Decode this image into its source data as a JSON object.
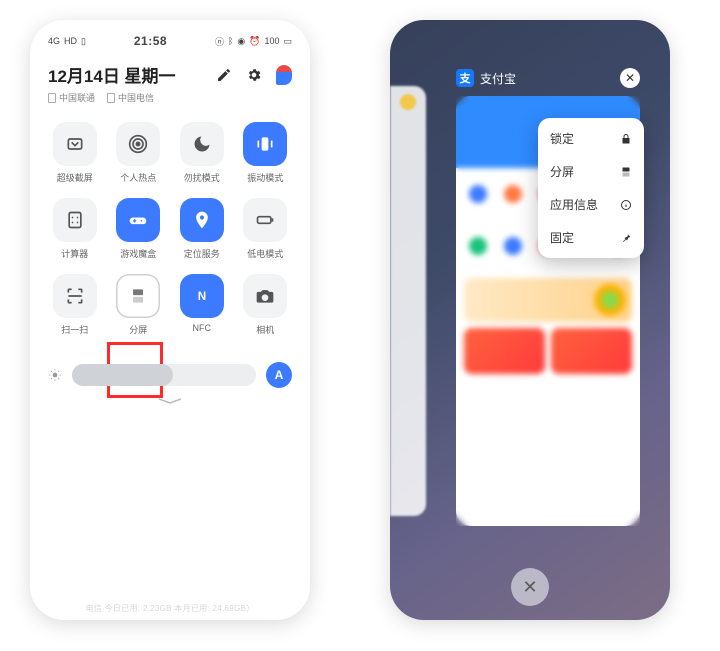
{
  "left": {
    "status": {
      "signal1": "4G",
      "signal2": "HD",
      "time": "21:58",
      "icons": [
        "nfc",
        "bt",
        "mute",
        "alarm",
        "batt_pct",
        "batt"
      ],
      "battery": "100"
    },
    "date": "12月14日 星期一",
    "sim1": "中国联通",
    "sim2": "中国电信",
    "tiles": [
      {
        "id": "super-screenshot",
        "label": "超级截屏",
        "active": false,
        "icon": "screenshot"
      },
      {
        "id": "hotspot",
        "label": "个人热点",
        "active": false,
        "icon": "hotspot"
      },
      {
        "id": "dnd",
        "label": "勿扰模式",
        "active": false,
        "icon": "moon"
      },
      {
        "id": "vibrate",
        "label": "振动模式",
        "active": true,
        "icon": "vibrate"
      },
      {
        "id": "calculator",
        "label": "计算器",
        "active": false,
        "icon": "calc"
      },
      {
        "id": "game-box",
        "label": "游戏魔盒",
        "active": true,
        "icon": "gamepad"
      },
      {
        "id": "location",
        "label": "定位服务",
        "active": true,
        "icon": "pin"
      },
      {
        "id": "low-power",
        "label": "低电模式",
        "active": false,
        "icon": "battery"
      },
      {
        "id": "scan",
        "label": "扫一扫",
        "active": false,
        "icon": "scan"
      },
      {
        "id": "split",
        "label": "分屏",
        "active": false,
        "icon": "split",
        "outline": true
      },
      {
        "id": "nfc",
        "label": "NFC",
        "active": true,
        "icon": "nfc"
      },
      {
        "id": "camera",
        "label": "相机",
        "active": false,
        "icon": "camera"
      }
    ],
    "auto_brightness": "A",
    "footer": "电信  今日已用: 2.23GB   本月已用: 24.69GB〉"
  },
  "right": {
    "app_name": "支付宝",
    "menu": [
      {
        "id": "lock",
        "label": "锁定",
        "icon": "lock"
      },
      {
        "id": "split",
        "label": "分屏",
        "icon": "split"
      },
      {
        "id": "info",
        "label": "应用信息",
        "icon": "info"
      },
      {
        "id": "pin",
        "label": "固定",
        "icon": "pin"
      }
    ],
    "close": "✕",
    "dock_close": "✕"
  }
}
